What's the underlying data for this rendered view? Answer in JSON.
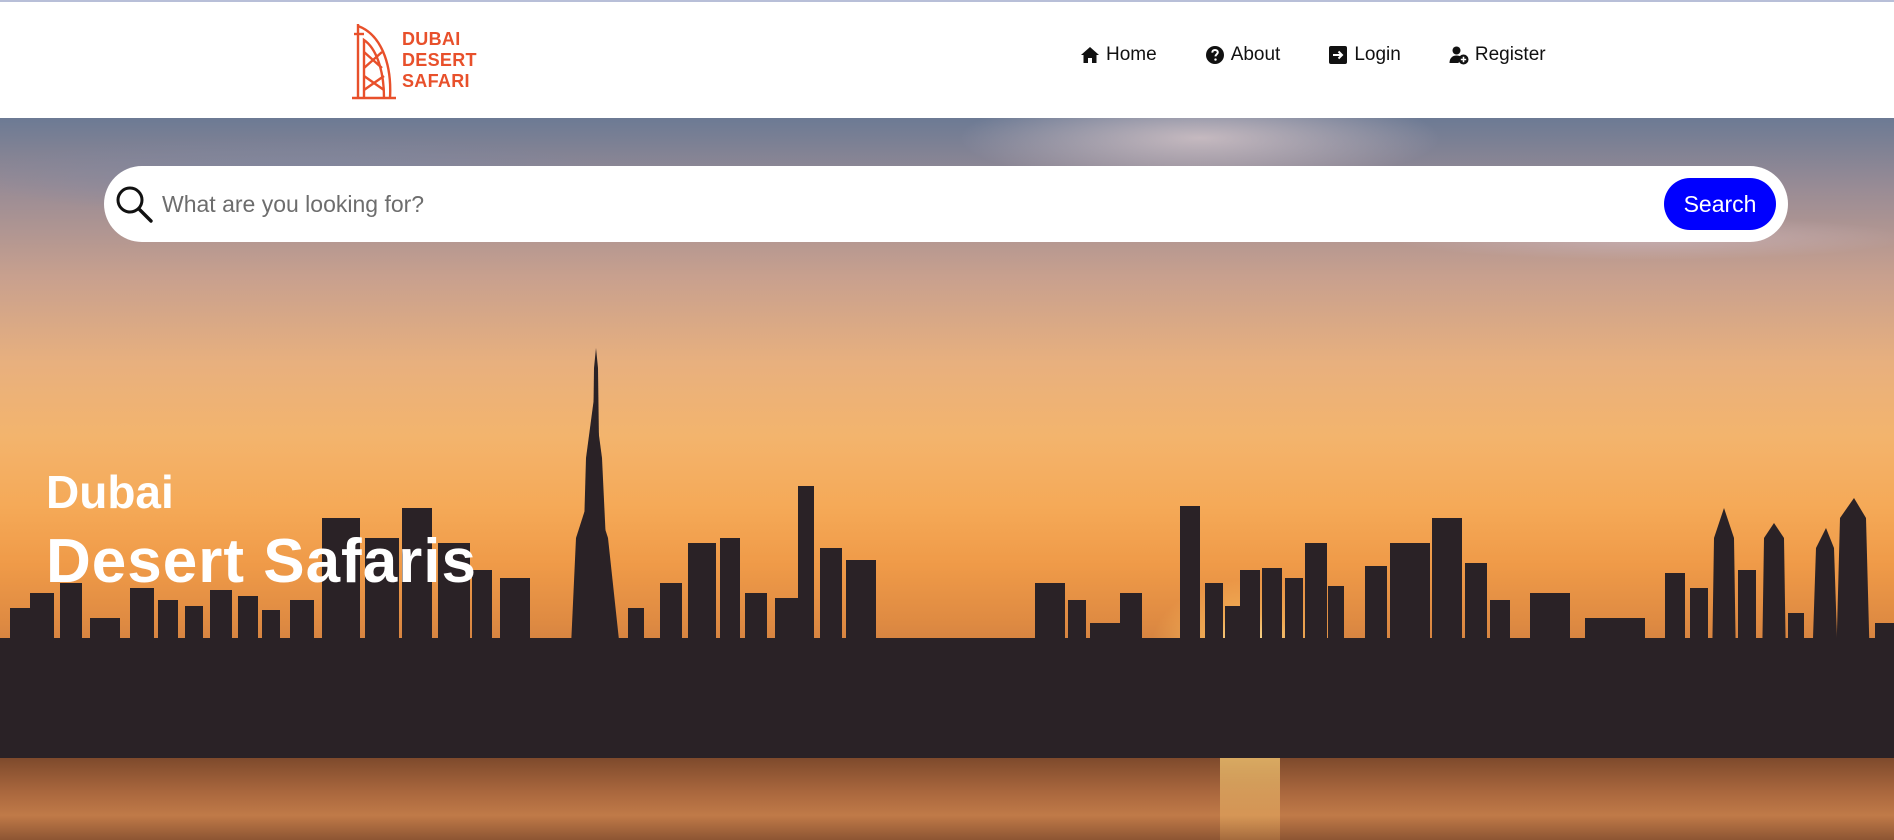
{
  "header": {
    "logo_lines": [
      "DUBAI",
      "DESERT",
      "SAFARI"
    ],
    "nav": [
      {
        "label": "Home",
        "icon": "home-icon"
      },
      {
        "label": "About",
        "icon": "question-circle-icon"
      },
      {
        "label": "Login",
        "icon": "login-icon"
      },
      {
        "label": "Register",
        "icon": "user-plus-icon"
      }
    ]
  },
  "search": {
    "placeholder": "What are you looking for?",
    "button_label": "Search"
  },
  "hero": {
    "subtitle": "Dubai",
    "title": "Desert Safaris",
    "background": "Dubai skyline at sunset"
  },
  "colors": {
    "brand": "#e8502b",
    "search_button": "#0000ff",
    "hero_text": "#ffffff"
  }
}
